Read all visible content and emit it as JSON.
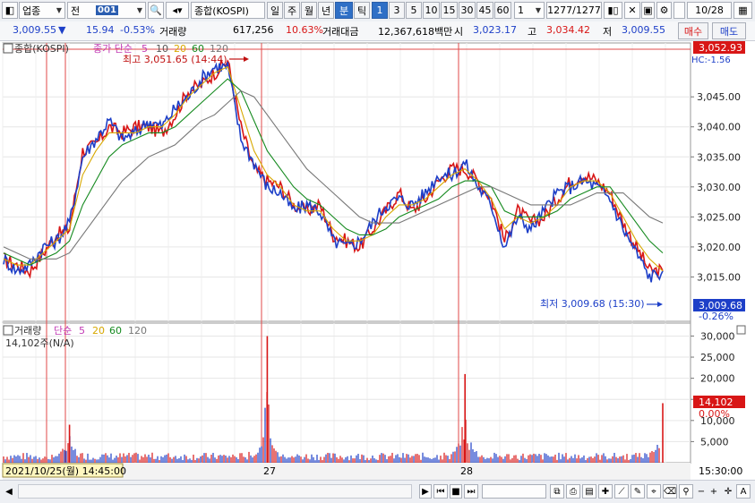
{
  "toolbar": {
    "market_select": "업종",
    "prev_label": "전",
    "code_value": "001",
    "stock_name": "종합(KOSPI)",
    "period_tabs": [
      "일",
      "주",
      "월",
      "년",
      "분",
      "틱"
    ],
    "active_tab": "분",
    "intervals": [
      "1",
      "3",
      "5",
      "10",
      "15",
      "30",
      "45",
      "60"
    ],
    "active_interval": "1",
    "interval_select": "1",
    "count_display": "1277/1277",
    "date_value": "10/28"
  },
  "info": {
    "price": "3,009.55",
    "direction": "▼",
    "change": "15.94",
    "change_pct": "-0.53%",
    "volume_label": "거래량",
    "volume": "617,256",
    "volume_pct": "10.63%",
    "amount_label": "거래대금",
    "amount": "12,367,618백만",
    "open_label": "시",
    "open": "3,023.17",
    "high_label": "고",
    "high": "3,034.42",
    "low_label": "저",
    "low": "3,009.55",
    "buy_label": "매수",
    "sell_label": "매도"
  },
  "chart_data": [
    {
      "type": "line",
      "title": "종합(KOSPI)",
      "legend": {
        "label": "종가 단순",
        "mas": [
          "5",
          "10",
          "20",
          "60",
          "120"
        ]
      },
      "ylim": [
        3009.55,
        3052.93
      ],
      "yticks": [
        3015,
        3020,
        3025,
        3030,
        3035,
        3040,
        3045
      ],
      "ytick_labels": [
        "3,015.00",
        "3,020.00",
        "3,025.00",
        "3,030.00",
        "3,035.00",
        "3,040.00",
        "3,045.00"
      ],
      "max_annotation": "최고 3,051.65 (14:44)",
      "min_annotation": "최저 3,009.68 (15:30)",
      "top_label": "3,052.93",
      "current_label": "3,009.68",
      "current_pct": "-0.26%",
      "right_top_label": "HC:-1.56",
      "x": [
        0,
        2,
        4,
        6,
        8,
        10,
        12,
        14,
        16,
        18,
        20,
        22,
        24,
        26,
        28,
        30,
        32,
        34,
        36,
        38,
        40,
        42,
        44,
        46,
        48,
        50,
        52,
        54,
        56,
        58,
        60,
        62,
        64,
        66,
        68,
        70,
        72,
        74,
        76,
        78,
        80,
        82,
        84,
        86,
        88,
        90,
        92,
        94,
        96,
        98,
        100
      ],
      "series": [
        {
          "color": "#d81616",
          "values": [
            3018,
            3017,
            3016,
            3019,
            3022,
            3023,
            3036,
            3037,
            3040,
            3039,
            3040,
            3040,
            3039,
            3042,
            3046,
            3047,
            3049,
            3051,
            3040,
            3033,
            3031,
            3030,
            3027,
            3026,
            3027,
            3022,
            3021,
            3020,
            3023,
            3026,
            3029,
            3026,
            3028,
            3031,
            3033,
            3033,
            3031,
            3028,
            3021,
            3026,
            3024,
            3025,
            3028,
            3031,
            3032,
            3031,
            3029,
            3024,
            3020,
            3016,
            3016
          ]
        },
        {
          "color": "#1d3fc8",
          "values": [
            3018,
            3016,
            3017,
            3020,
            3021,
            3024,
            3035,
            3038,
            3041,
            3038,
            3039,
            3041,
            3040,
            3043,
            3045,
            3048,
            3050,
            3050,
            3038,
            3034,
            3030,
            3029,
            3026,
            3027,
            3026,
            3021,
            3020,
            3021,
            3024,
            3027,
            3028,
            3027,
            3029,
            3032,
            3032,
            3034,
            3030,
            3027,
            3020,
            3025,
            3023,
            3026,
            3029,
            3030,
            3031,
            3030,
            3028,
            3023,
            3019,
            3015,
            3016
          ]
        }
      ],
      "ma_lines": [
        {
          "name": "20",
          "color": "#d8a800",
          "values": [
            3018,
            3017,
            3017,
            3019,
            3021,
            3023,
            3032,
            3036,
            3039,
            3039,
            3039,
            3040,
            3040,
            3042,
            3045,
            3047,
            3049,
            3050,
            3043,
            3036,
            3032,
            3030,
            3027,
            3026,
            3026,
            3023,
            3021,
            3021,
            3022,
            3025,
            3027,
            3027,
            3028,
            3030,
            3032,
            3033,
            3031,
            3028,
            3023,
            3025,
            3024,
            3025,
            3027,
            3030,
            3031,
            3031,
            3029,
            3025,
            3021,
            3018,
            3016
          ]
        },
        {
          "name": "60",
          "color": "#158a1f",
          "values": [
            3019,
            3018,
            3017,
            3018,
            3019,
            3021,
            3027,
            3031,
            3035,
            3037,
            3038,
            3039,
            3039,
            3040,
            3042,
            3044,
            3046,
            3048,
            3046,
            3041,
            3036,
            3033,
            3030,
            3028,
            3027,
            3025,
            3023,
            3022,
            3022,
            3023,
            3025,
            3026,
            3027,
            3028,
            3030,
            3031,
            3031,
            3030,
            3026,
            3025,
            3025,
            3025,
            3026,
            3028,
            3029,
            3030,
            3030,
            3027,
            3024,
            3021,
            3019
          ]
        },
        {
          "name": "120",
          "color": "#777777",
          "values": [
            3020,
            3019,
            3018,
            3018,
            3018,
            3019,
            3022,
            3025,
            3028,
            3031,
            3033,
            3035,
            3036,
            3037,
            3039,
            3041,
            3042,
            3044,
            3046,
            3045,
            3042,
            3039,
            3036,
            3033,
            3031,
            3029,
            3027,
            3025,
            3024,
            3024,
            3024,
            3025,
            3026,
            3027,
            3028,
            3029,
            3030,
            3030,
            3029,
            3028,
            3027,
            3027,
            3027,
            3027,
            3028,
            3029,
            3029,
            3029,
            3027,
            3025,
            3024
          ]
        }
      ]
    },
    {
      "type": "bar",
      "title": "거래량",
      "legend": {
        "label": "단순",
        "mas": [
          "5",
          "20",
          "60",
          "120"
        ]
      },
      "volume_readout": "14,102주(N/A)",
      "ylim": [
        0,
        32000
      ],
      "yticks": [
        5000,
        10000,
        15000,
        20000,
        25000,
        30000
      ],
      "ytick_labels": [
        "5,000",
        "10,000",
        "15,000",
        "20,000",
        "25,000",
        "30,000"
      ],
      "current_label": "14,102",
      "current_pct": "0.00%",
      "x_labels": [
        "2021/10/25(월) 14:45:00",
        "27",
        "28"
      ],
      "right_x_label": "15:30:00",
      "spikes": [
        {
          "x": 10,
          "value": 9000
        },
        {
          "x": 40,
          "value": 30000
        },
        {
          "x": 70,
          "value": 21000
        },
        {
          "x": 100,
          "value": 14102
        }
      ],
      "base_volume": 1500
    }
  ]
}
